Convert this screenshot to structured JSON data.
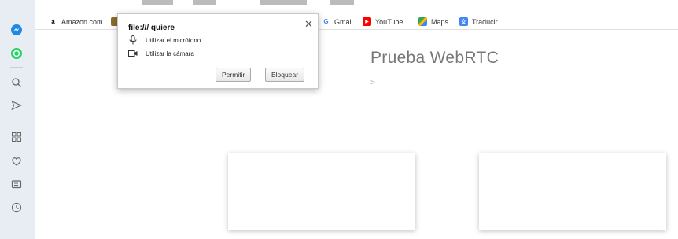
{
  "bookmarks": [
    {
      "label": "Amazon.com",
      "icon": "amazon-icon"
    },
    {
      "label": "Gmail",
      "icon": "google-icon"
    },
    {
      "label": "YouTube",
      "icon": "youtube-icon"
    },
    {
      "label": "Maps",
      "icon": "maps-icon"
    },
    {
      "label": "Traducir",
      "icon": "translate-icon"
    }
  ],
  "sidebar": {
    "items": [
      "messenger-icon",
      "whatsapp-icon",
      "search-icon",
      "send-icon",
      "grid-icon",
      "heart-icon",
      "wallet-icon",
      "history-icon"
    ]
  },
  "page": {
    "title": "Prueba WebRTC",
    "gt": ">"
  },
  "popup": {
    "title": "file:/// quiere",
    "close": "✕",
    "permissions": [
      {
        "label": "Utilizar el micrófono",
        "icon": "microphone-icon"
      },
      {
        "label": "Utilizar la cámara",
        "icon": "camera-icon"
      }
    ],
    "allow_label": "Permitir",
    "block_label": "Bloquear"
  },
  "colors": {
    "sidebar_bg": "#e8edf3",
    "messenger": "#1e88e5",
    "whatsapp": "#25d366",
    "youtube": "#ff0000"
  }
}
